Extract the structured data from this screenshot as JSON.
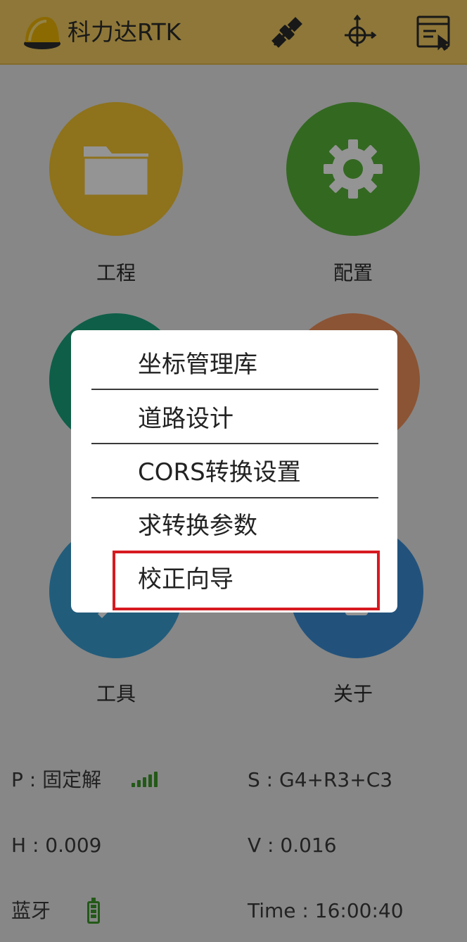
{
  "app": {
    "title": "科力达RTK",
    "theme_color": "#f4cd63",
    "icons": [
      "helmet-logo-icon",
      "satellite-icon",
      "crosshair-target-icon",
      "window-click-icon"
    ]
  },
  "tiles": [
    {
      "label": "工程",
      "color": "#f4c431",
      "icon": "folder-icon"
    },
    {
      "label": "配置",
      "color": "#59b43a",
      "icon": "gear-icon"
    },
    {
      "label": "",
      "color": "#1aa27c",
      "icon": ""
    },
    {
      "label": "",
      "color": "#f0925a",
      "icon": ""
    },
    {
      "label": "工具",
      "color": "#3b9fd5",
      "icon": "wrench-icon"
    },
    {
      "label": "关于",
      "color": "#3b8ed6",
      "icon": "info-icon"
    }
  ],
  "status": {
    "position_label": "P : 固定解",
    "satellites_label": "S : G4+R3+C3",
    "h_label": "H : 0.009",
    "v_label": "V : 0.016",
    "bluetooth_label": "蓝牙",
    "time_label": "Time :   16:00:40",
    "signal_icon": "signal-bars-icon",
    "battery_icon": "battery-icon",
    "status_color": "#3d9a2a"
  },
  "popup_menu": {
    "items": [
      "坐标管理库",
      "道路设计",
      "CORS转换设置",
      "求转换参数",
      "校正向导"
    ],
    "highlight_color": "#d71920"
  }
}
